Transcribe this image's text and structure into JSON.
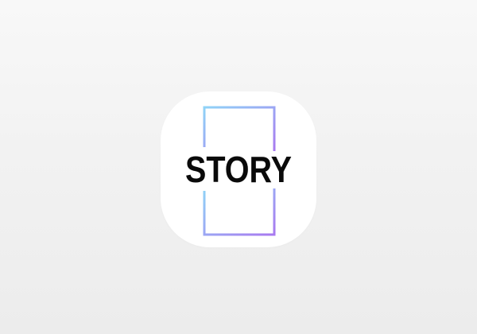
{
  "app_icon": {
    "logo_text": "STORY",
    "frame_gradient": {
      "start": "#8fd3f7",
      "end": "#a879f0"
    },
    "background": "#ffffff",
    "text_color": "#0a0a0a"
  },
  "page": {
    "background": "#f2f2f2"
  }
}
